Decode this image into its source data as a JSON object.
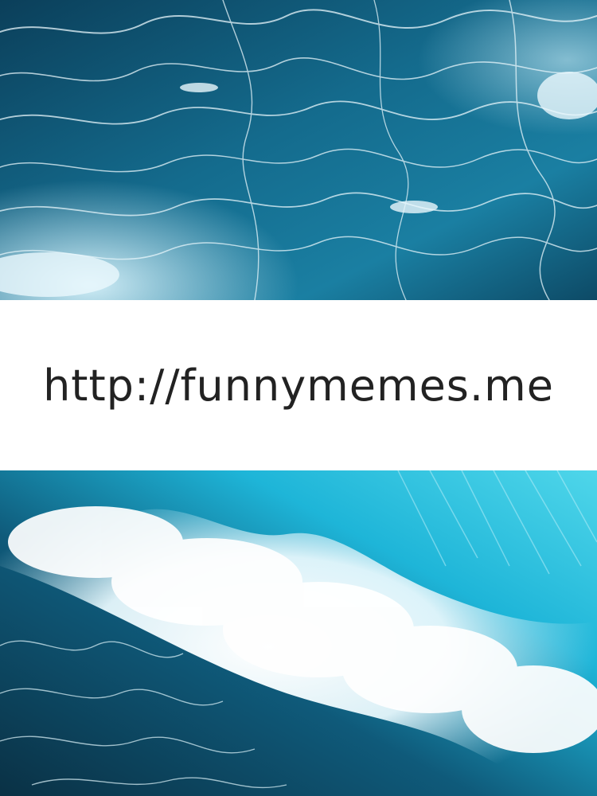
{
  "caption": {
    "url": "http://funnymemes.me"
  },
  "photos": {
    "top": {
      "subject": "ocean-water-surface",
      "colors": [
        "#0b3f5a",
        "#146b8d",
        "#1f8fb0",
        "#e8f6fb"
      ]
    },
    "bottom": {
      "subject": "crashing-ocean-wave",
      "colors": [
        "#0a3145",
        "#0f5a7a",
        "#1eb5d8",
        "#4fd6ea",
        "#ffffff"
      ]
    }
  }
}
